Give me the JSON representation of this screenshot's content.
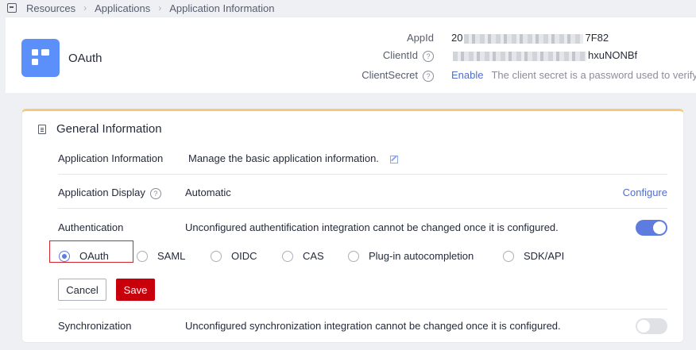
{
  "breadcrumb": {
    "items": [
      "Resources",
      "Applications",
      "Application Information"
    ]
  },
  "app": {
    "name": "OAuth",
    "appid_label": "AppId",
    "appid_prefix": "20",
    "appid_suffix": "7F82",
    "clientid_label": "ClientId",
    "clientid_prefix": "",
    "clientid_suffix": "hxuNONBf",
    "clientsecret_label": "ClientSecret",
    "enable_label": "Enable",
    "clientsecret_hint": "The client secret is a password used to verify"
  },
  "general": {
    "title": "General Information",
    "app_info_label": "Application Information",
    "app_info_text": "Manage the basic application information.",
    "display_label": "Application Display",
    "display_value": "Automatic",
    "configure_label": "Configure",
    "auth_label": "Authentication",
    "auth_text": "Unconfigured authentification integration cannot be changed once it is configured.",
    "auth_enabled": true,
    "auth_options": [
      "OAuth",
      "SAML",
      "OIDC",
      "CAS",
      "Plug-in autocompletion",
      "SDK/API"
    ],
    "auth_selected": "OAuth",
    "cancel_label": "Cancel",
    "save_label": "Save",
    "sync_label": "Synchronization",
    "sync_text": "Unconfigured synchronization integration cannot be changed once it is configured.",
    "sync_enabled": false
  },
  "colors": {
    "accent": "#5e7ce0",
    "save": "#c7000b",
    "card_top": "#f5c87c",
    "logo": "#5b8ff9"
  },
  "icons": [
    "folder-icon",
    "app-grid-icon",
    "help-icon",
    "document-icon",
    "edit-icon"
  ]
}
